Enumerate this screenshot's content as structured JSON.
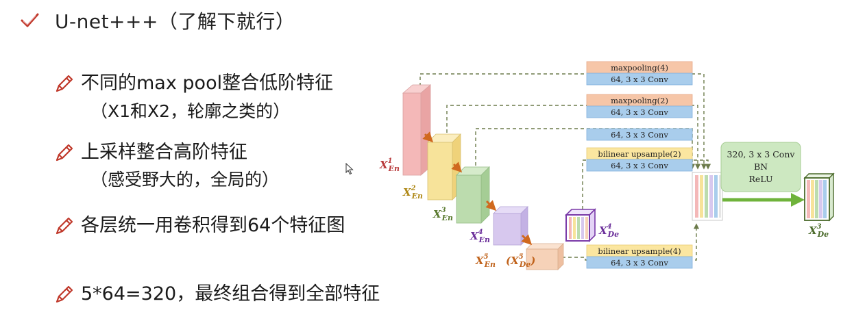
{
  "slide": {
    "title": "U-net+++（了解下就行）",
    "bullets": [
      {
        "main": "不同的max pool整合低阶特征",
        "sub": "（X1和X2，轮廓之类的）"
      },
      {
        "main": "上采样整合高阶特征",
        "sub": "（感受野大的，全局的）"
      },
      {
        "main": "各层统一用卷积得到64个特征图",
        "sub": ""
      },
      {
        "main": "5*64=320，最终组合得到全部特征",
        "sub": ""
      }
    ]
  },
  "diagram": {
    "blocks": [
      {
        "top": "maxpooling(4)",
        "bottom": "64, 3 x 3 Conv"
      },
      {
        "top": "maxpooling(2)",
        "bottom": "64, 3 x 3 Conv"
      },
      {
        "top": "",
        "bottom": "64, 3 x 3 Conv"
      },
      {
        "top": "bilinear upsample(2)",
        "bottom": "64, 3 x 3 Conv"
      },
      {
        "top": "bilinear upsample(4)",
        "bottom": "64, 3 x 3 Conv"
      }
    ],
    "final_conv": [
      "320, 3 x 3 Conv",
      "BN",
      "ReLU"
    ],
    "encoder_labels": [
      {
        "base": "X",
        "sup": "1",
        "sub": "En"
      },
      {
        "base": "X",
        "sup": "2",
        "sub": "En"
      },
      {
        "base": "X",
        "sup": "3",
        "sub": "En"
      },
      {
        "base": "X",
        "sup": "4",
        "sub": "En"
      },
      {
        "base": "X",
        "sup": "5",
        "sub": "En"
      }
    ],
    "x5_paren_open": "(",
    "x5_paren_base": "X",
    "x5_paren_sup": "5",
    "x5_paren_sub": "De",
    "x5_paren_close": ")",
    "decoder4_label": {
      "base": "X",
      "sup": "4",
      "sub": "De"
    },
    "decoder3_label": {
      "base": "X",
      "sup": "3",
      "sub": "De"
    },
    "colors": {
      "en1": "#f4b8b8",
      "en2": "#f7e39a",
      "en3": "#bcdcae",
      "en4": "#d7c8ee",
      "en5": "#f6d2b8",
      "pool_box": "#f6c6a8",
      "up_box": "#fbe6a0",
      "conv_box": "#a9cdec",
      "final_box": "#cde8c1",
      "final_arrow": "#6fb33b",
      "arrow_orange": "#d0691f",
      "dash": "#6b7a4a",
      "label_red": "#b8393b",
      "label_gold": "#b08a1a",
      "label_green": "#5a7a2f",
      "label_purple": "#6b2f9a",
      "label_orange": "#c0621a",
      "label_dark_green": "#4a6a2a"
    }
  }
}
